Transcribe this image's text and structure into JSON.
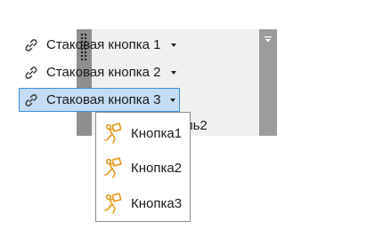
{
  "toolbar": {
    "buttons": [
      {
        "label": "Стаковая кнопка 1",
        "icon": "link-icon"
      },
      {
        "label": "Стаковая кнопка 2",
        "icon": "link-icon"
      },
      {
        "label": "Стаковая кнопка 3",
        "icon": "link-icon",
        "active": true
      }
    ],
    "partial_label": "ель2"
  },
  "dropdown": {
    "items": [
      {
        "label": "Кнопка1",
        "icon": "worker-carrying-box-icon"
      },
      {
        "label": "Кнопка2",
        "icon": "worker-carrying-box-icon"
      },
      {
        "label": "Кнопка3",
        "icon": "worker-carrying-box-icon"
      }
    ]
  },
  "colors": {
    "active_fill": "#c4dcf4",
    "active_border": "#3c8fd8",
    "icon_orange": "#e39a1c",
    "panel_gray": "#a2a2a2"
  }
}
